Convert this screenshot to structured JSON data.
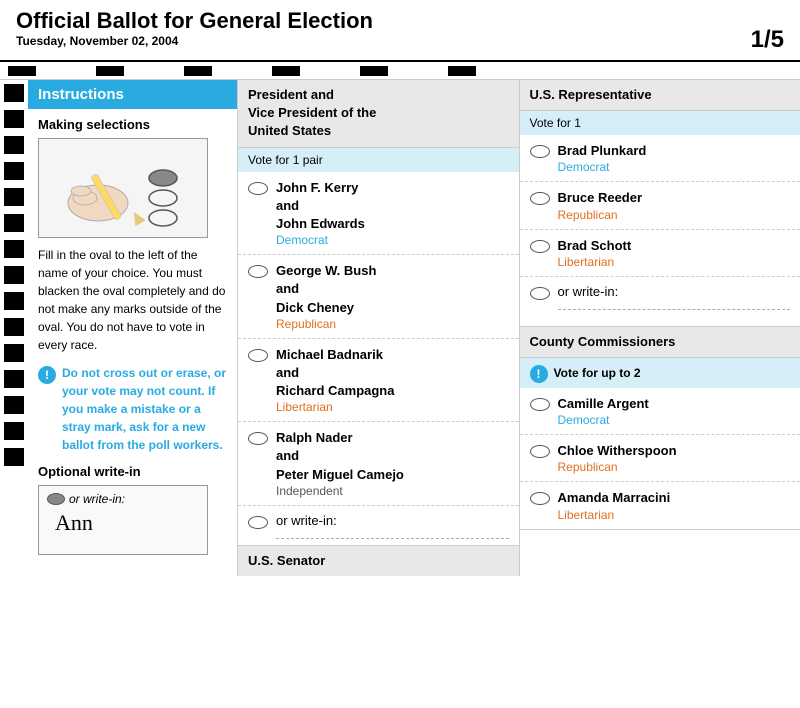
{
  "header": {
    "title": "Official Ballot for General Election",
    "date": "Tuesday, November 02, 2004",
    "page": "1",
    "total_pages": "5"
  },
  "instructions": {
    "header": "Instructions",
    "making_selections": "Making selections",
    "fill_text": "Fill in the oval to the left of the name of your choice. You must blacken the oval completely and do not make any marks outside of the oval. You do not have to vote in every race.",
    "warning_text": "Do not cross out or erase, or your vote may not count. If you make a mistake or a stray mark, ask for a new ballot from the poll workers.",
    "optional_write_in": "Optional write-in",
    "write_in_label": "or write-in:",
    "write_in_example": "Ann"
  },
  "contests": [
    {
      "id": "president",
      "title": "President and Vice President of the United States",
      "vote_instruction": "Vote for 1 pair",
      "candidates": [
        {
          "name": "John F. Kerry\nand\nJohn Edwards",
          "party": "Democrat",
          "party_class": "democrat"
        },
        {
          "name": "George W. Bush\nand\nDick Cheney",
          "party": "Republican",
          "party_class": "republican"
        },
        {
          "name": "Michael Badnarik\nand\nRichard Campagna",
          "party": "Libertarian",
          "party_class": "libertarian"
        },
        {
          "name": "Ralph Nader\nand\nPeter Miguel Camejo",
          "party": "Independent",
          "party_class": "independent"
        }
      ],
      "write_in": "or write-in:"
    },
    {
      "id": "us-representative",
      "title": "U.S. Representative",
      "vote_instruction": "Vote for 1",
      "candidates": [
        {
          "name": "Brad Plunkard",
          "party": "Democrat",
          "party_class": "democrat"
        },
        {
          "name": "Bruce Reeder",
          "party": "Republican",
          "party_class": "republican"
        },
        {
          "name": "Brad Schott",
          "party": "Libertarian",
          "party_class": "libertarian"
        }
      ],
      "write_in": "or write-in:"
    },
    {
      "id": "county-commissioners",
      "title": "County Commissioners",
      "vote_instruction": "Vote for up to 2",
      "vote_warning": true,
      "candidates": [
        {
          "name": "Camille Argent",
          "party": "Democrat",
          "party_class": "democrat"
        },
        {
          "name": "Chloe Witherspoon",
          "party": "Republican",
          "party_class": "republican"
        },
        {
          "name": "Amanda Marracini",
          "party": "Libertarian",
          "party_class": "libertarian"
        }
      ]
    }
  ],
  "us_senator_label": "U.S. Senator"
}
